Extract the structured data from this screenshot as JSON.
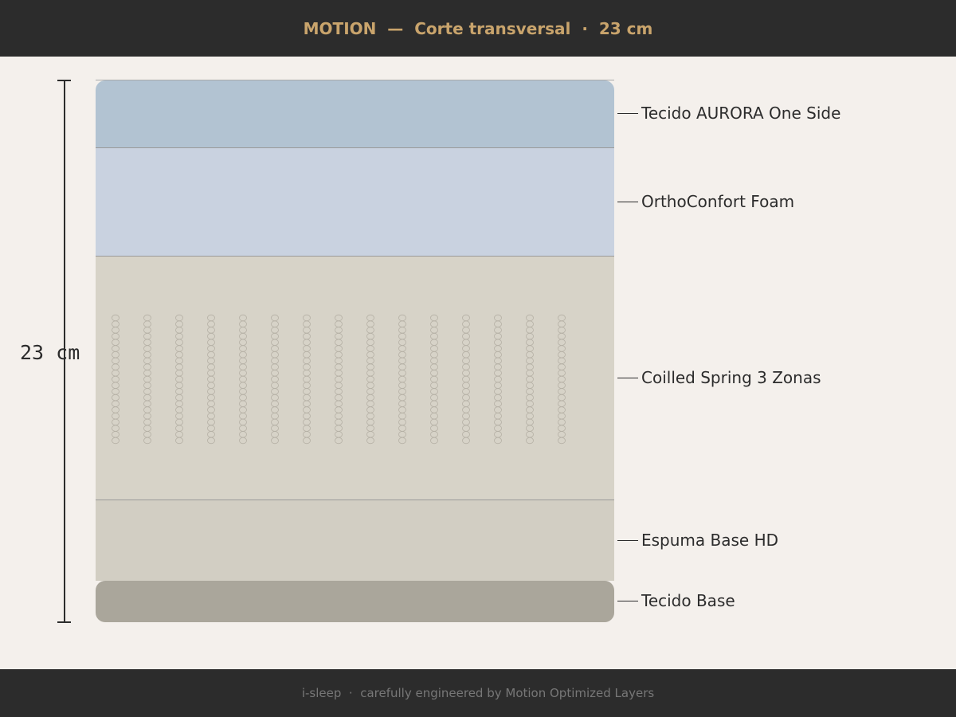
{
  "header": {
    "title": "MOTION  —  Corte transversal  ·  23 cm"
  },
  "dimension": {
    "label": "23 cm",
    "total_cm": 23
  },
  "layers": [
    {
      "name": "Tecido AURORA One Side",
      "color": "#b2c3d2"
    },
    {
      "name": "OrthoConfort Foam",
      "color": "#c9d2e0"
    },
    {
      "name": "Coilled Spring 3 Zonas",
      "color": "#d7d3c8",
      "coil_color": "#b5b0a5"
    },
    {
      "name": "Espuma Base HD",
      "color": "#d2cec3"
    },
    {
      "name": "Tecido Base",
      "color": "#aaa69b"
    }
  ],
  "footer": {
    "text": "i-sleep  ·  carefully engineered by Motion Optimized Layers"
  },
  "colors": {
    "bar": "#2c2c2c",
    "accent": "#c9a46c",
    "background": "#f4f0ec"
  }
}
